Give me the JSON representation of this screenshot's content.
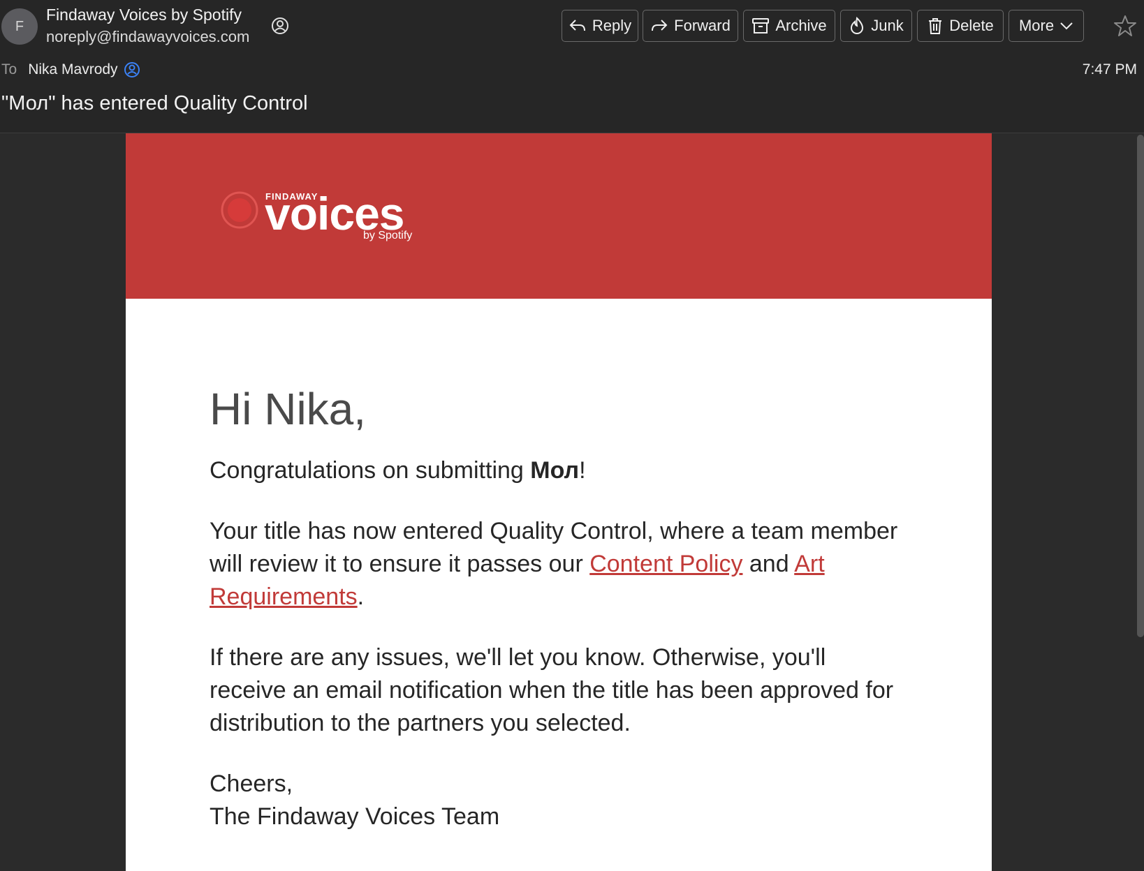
{
  "header": {
    "avatar_letter": "F",
    "sender_name": "Findaway Voices by Spotify",
    "sender_email": "noreply@findawayvoices.com",
    "to_label": "To",
    "to_name": "Nika Mavrody",
    "time": "7:47 PM",
    "subject": "\"Мол\" has entered Quality Control"
  },
  "toolbar": {
    "reply": "Reply",
    "forward": "Forward",
    "archive": "Archive",
    "junk": "Junk",
    "delete": "Delete",
    "more": "More"
  },
  "logo": {
    "small": "FINDAWAY",
    "main": "voices",
    "by": "by Spotify"
  },
  "body": {
    "greeting": "Hi Nika,",
    "p1_prefix": "Congratulations on submitting ",
    "p1_title": "Мол",
    "p1_suffix": "!",
    "p2_prefix": "Your title has now entered Quality Control, where a team member will review it to ensure it passes our ",
    "p2_link1": "Content Policy",
    "p2_mid": " and ",
    "p2_link2": "Art Requirements",
    "p2_suffix": ".",
    "p3": "If there are any issues, we'll let you know. Otherwise, you'll receive an email notification when the title has been approved for distribution to the partners you selected.",
    "closing": "Cheers,",
    "signature": "The Findaway Voices Team"
  },
  "colors": {
    "brand_red": "#c13a38",
    "header_bg": "#262626",
    "page_bg": "#2b2b2b"
  },
  "icons": [
    "contact-icon",
    "reply-icon",
    "forward-icon",
    "archive-icon",
    "junk-icon",
    "delete-icon",
    "chevron-down-icon",
    "star-icon",
    "person-badge-icon"
  ]
}
